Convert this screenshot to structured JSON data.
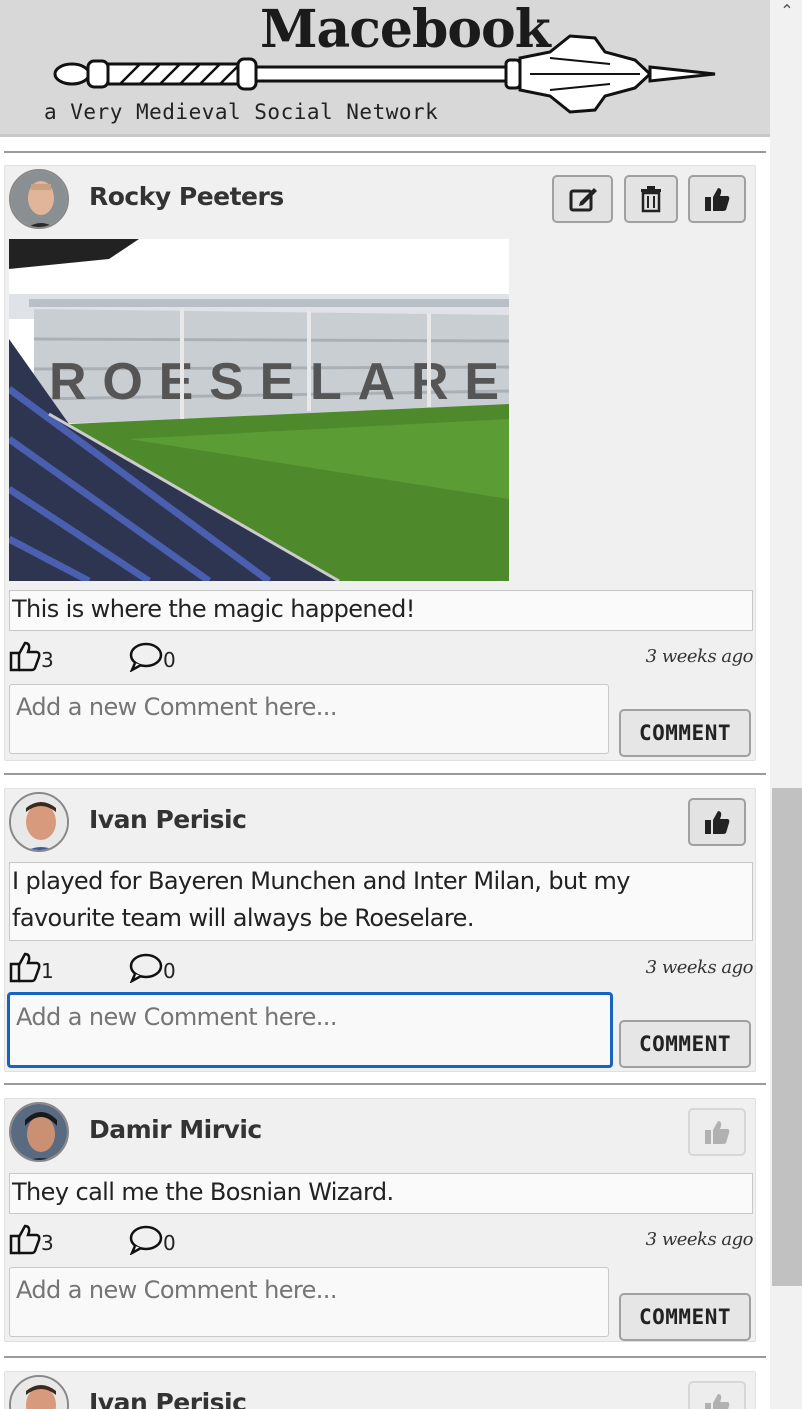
{
  "header": {
    "title": "Macebook",
    "tagline": "a Very Medieval Social Network"
  },
  "comment_placeholder": "Add a new Comment here...",
  "comment_button_label": "COMMENT",
  "posts": [
    {
      "author": "Rocky Peeters",
      "text": "This is where the magic happened!",
      "likes": "3",
      "comments": "0",
      "time": "3 weeks ago",
      "has_image": true,
      "image_text": "ROESELARE",
      "buttons": [
        "edit-icon",
        "trash-icon",
        "thumbs-up-icon"
      ]
    },
    {
      "author": "Ivan Perisic",
      "text_line1": "I played for Bayeren Munchen and Inter Milan, but my",
      "text_line2": "favourite team will always be Roeselare.",
      "likes": "1",
      "comments": "0",
      "time": "3 weeks ago",
      "buttons": [
        "thumbs-up-icon"
      ]
    },
    {
      "author": "Damir Mirvic",
      "text": "They call me the Bosnian Wizard.",
      "likes": "3",
      "comments": "0",
      "time": "3 weeks ago",
      "buttons": [
        "thumbs-up-icon"
      ],
      "like_disabled": true
    },
    {
      "author": "Ivan Perisic",
      "buttons": [
        "thumbs-up-icon"
      ],
      "like_disabled": true
    }
  ],
  "colors": {
    "header_bg": "#d8d8d8",
    "card_bg": "#f0f0f0",
    "focus_border": "#1565c0"
  }
}
